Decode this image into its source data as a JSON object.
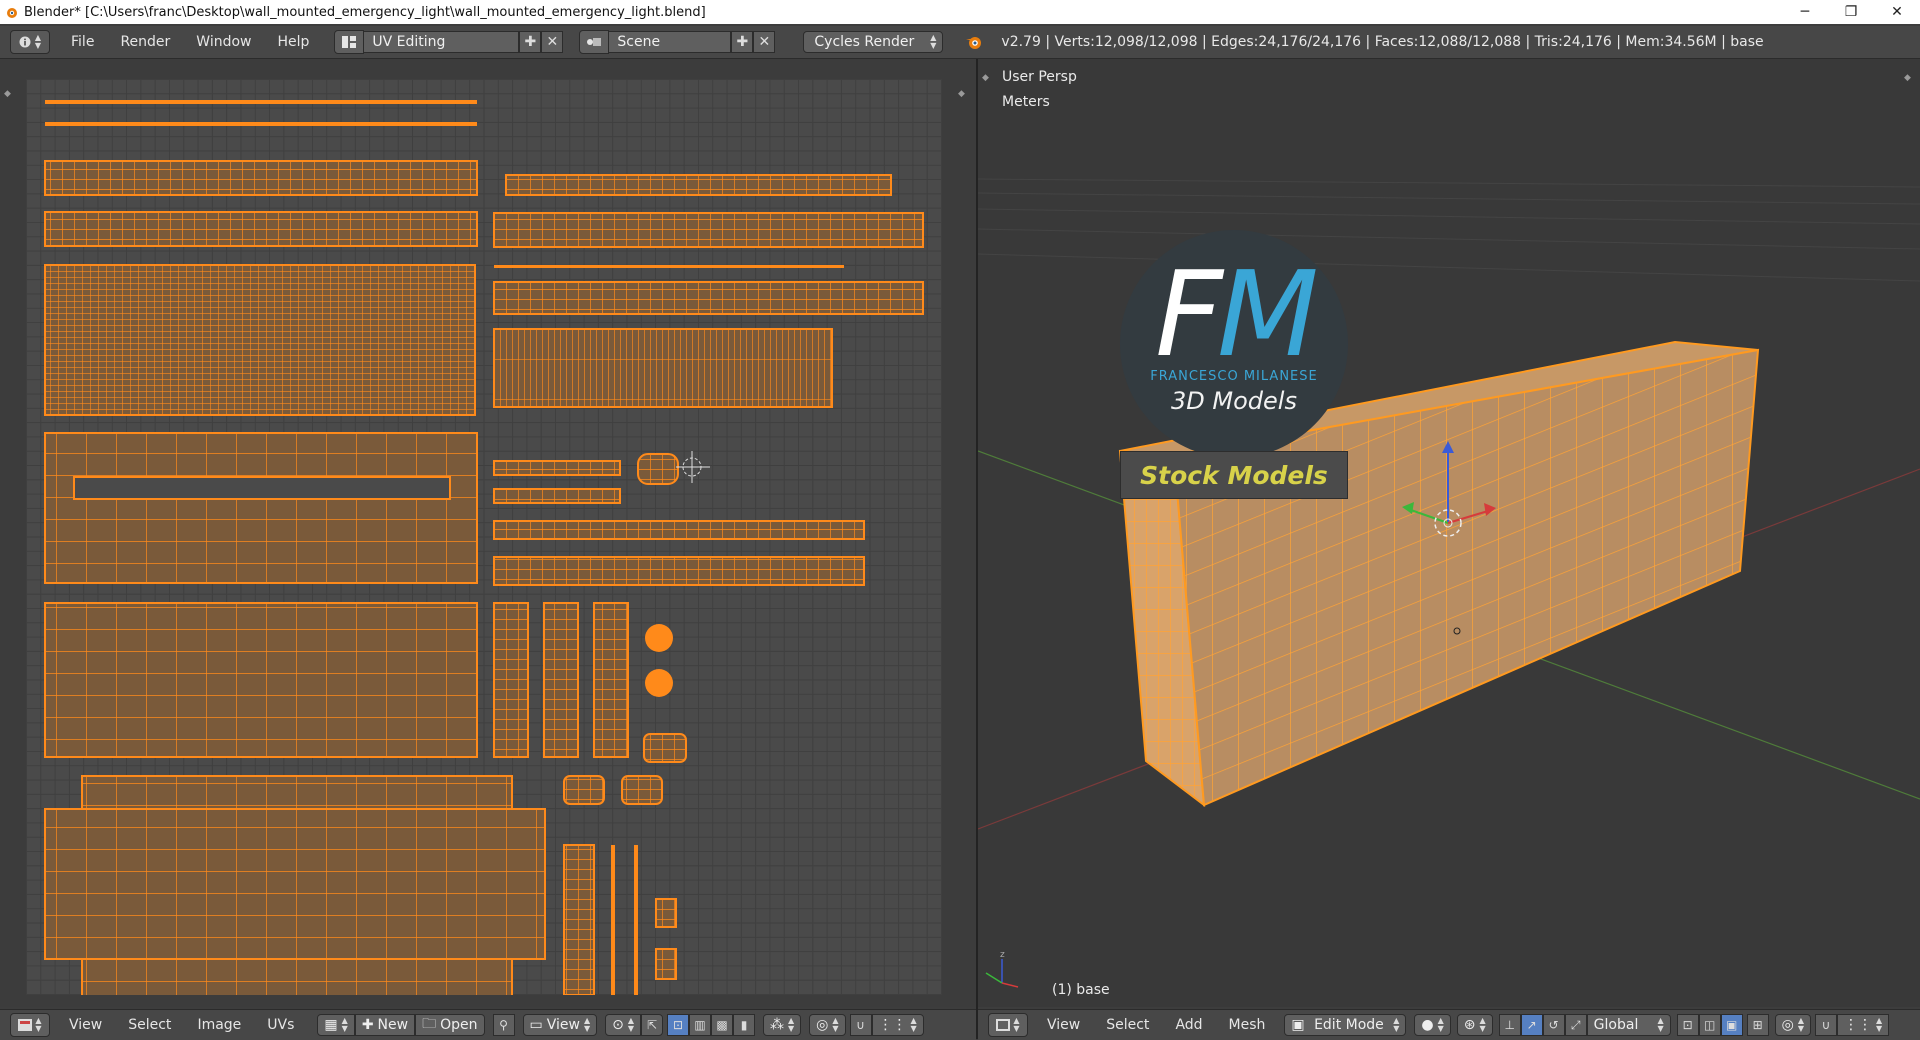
{
  "window": {
    "title": "Blender* [C:\\Users\\franc\\Desktop\\wall_mounted_emergency_light\\wall_mounted_emergency_light.blend]",
    "minimize": "─",
    "restore": "❐",
    "close": "✕"
  },
  "info_header": {
    "menus": [
      "File",
      "Render",
      "Window",
      "Help"
    ],
    "screen_layout": "UV Editing",
    "scene": "Scene",
    "render_engine": "Cycles Render",
    "stats": "v2.79 | Verts:12,098/12,098 | Edges:24,176/24,176 | Faces:12,088/12,088 | Tris:24,176 | Mem:34.56M | base"
  },
  "viewport": {
    "view_label": "User Persp",
    "units_label": "Meters",
    "object_label": "(1) base",
    "logo": {
      "initials": "FM",
      "author": "FRANCESCO MILANESE",
      "tagline": "3D Models",
      "badge": "Stock Models"
    }
  },
  "uv_footer": {
    "menus": [
      "View",
      "Select",
      "Image",
      "UVs"
    ],
    "new_label": "New",
    "open_label": "Open",
    "view_label": "View"
  },
  "vp_footer": {
    "menus": [
      "View",
      "Select",
      "Add",
      "Mesh"
    ],
    "mode": "Edit Mode",
    "orientation": "Global"
  },
  "colors": {
    "uv_wire": "#ff8a1a",
    "uv_fill": "#7a5a3a",
    "mesh_face": "#c89a6a",
    "logo_blue": "#3aa6d6",
    "badge_text": "#d8d24a"
  }
}
